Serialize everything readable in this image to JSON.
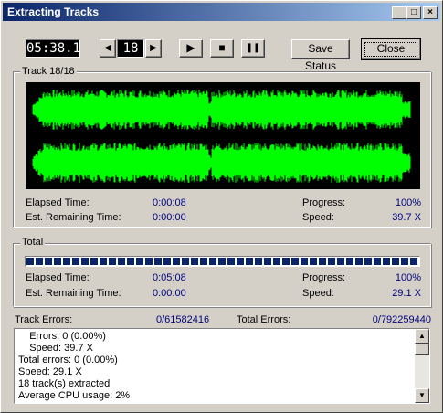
{
  "window": {
    "title": "Extracting Tracks",
    "minimize_label": "_",
    "maximize_label": "□",
    "close_label": "×"
  },
  "toolbar": {
    "time": "05:38.1",
    "track_number": "18",
    "prev_label": "◀",
    "next_label": "▶",
    "play_label": "▶",
    "stop_label": "■",
    "pause_label": "❚❚",
    "save_status_label": "Save Status",
    "close_label": "Close"
  },
  "track": {
    "group_label": "Track 18/18",
    "elapsed_label": "Elapsed Time:",
    "elapsed_value": "0:00:08",
    "remaining_label": "Est. Remaining Time:",
    "remaining_value": "0:00:00",
    "progress_label": "Progress:",
    "progress_value": "100%",
    "speed_label": "Speed:",
    "speed_value": "39.7 X"
  },
  "total": {
    "group_label": "Total",
    "progress_fraction": 1.0,
    "elapsed_label": "Elapsed Time:",
    "elapsed_value": "0:05:08",
    "remaining_label": "Est. Remaining Time:",
    "remaining_value": "0:00:00",
    "progress_label": "Progress:",
    "progress_value": "100%",
    "speed_label": "Speed:",
    "speed_value": "29.1 X"
  },
  "errors": {
    "track_label": "Track Errors:",
    "track_value": "0/61582416",
    "total_label": "Total Errors:",
    "total_value": "0/792259440"
  },
  "log": {
    "lines": [
      "    Errors: 0 (0.00%)",
      "    Speed: 39.7 X",
      "Total errors: 0 (0.00%)",
      "Speed: 29.1 X",
      "18 track(s) extracted",
      "Average CPU usage: 2%"
    ],
    "scroll_up_label": "▲",
    "scroll_down_label": "▼"
  },
  "colors": {
    "waveform": "#00ff00",
    "progress_block": "#0a246a",
    "value_text": "#00007b"
  }
}
